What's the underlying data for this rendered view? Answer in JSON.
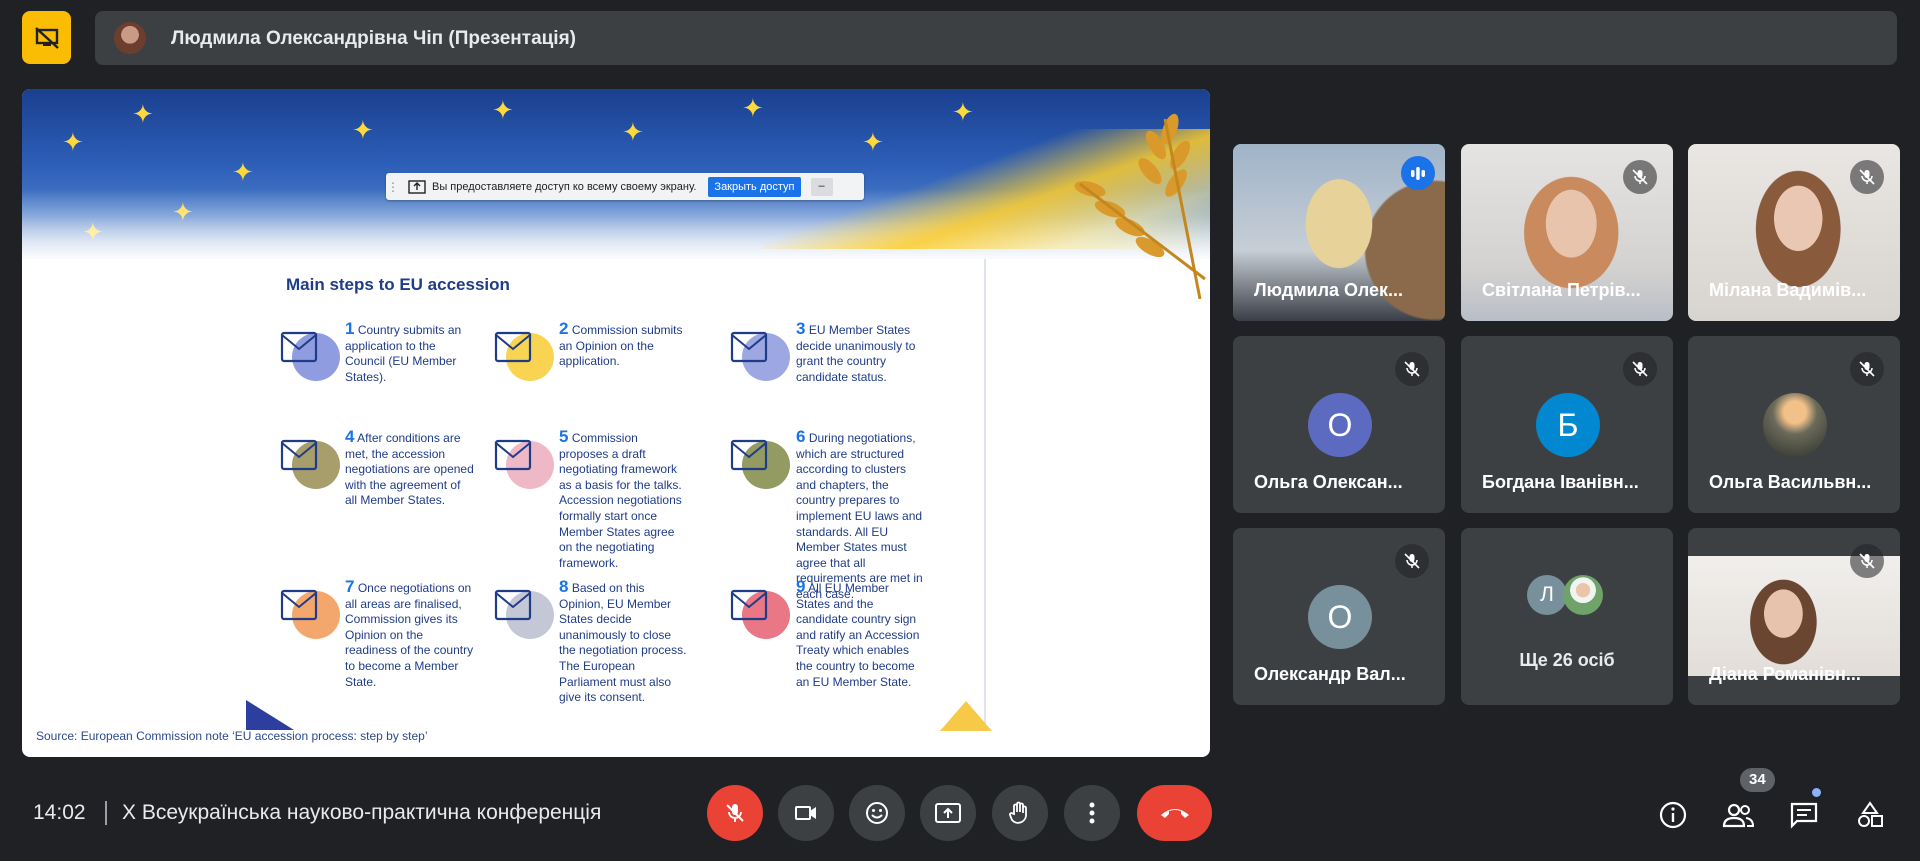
{
  "header": {
    "presenter_title": "Людмила Олександрівна Чіп (Презентація)"
  },
  "share_bar": {
    "message": "Вы предоставляете доступ ко всему своему экрану.",
    "stop_label": "Закрыть доступ"
  },
  "slide": {
    "heading": "Main steps to EU accession",
    "steps": [
      {
        "num": "1",
        "text": "Country submits an application to the Council (EU Member States).",
        "icon": "envelope-icon"
      },
      {
        "num": "2",
        "text": "Commission submits an Opinion on the application.",
        "icon": "speech-bubble-icon"
      },
      {
        "num": "3",
        "text": "EU Member States decide unanimously to grant the country candidate status.",
        "icon": "raised-hands-icon"
      },
      {
        "num": "4",
        "text": "After conditions are met, the accession negotiations are opened with the agreement of all Member States.",
        "icon": "scales-icon"
      },
      {
        "num": "5",
        "text": "Commission proposes a draft negotiating framework as a basis for the talks. Accession negotiations formally start once Member States agree on the negotiating framework.",
        "icon": "document-pen-icon"
      },
      {
        "num": "6",
        "text": "During negotiations, which are structured according to clusters and chapters, the country prepares to implement EU laws and standards. All EU Member States must agree that all requirements are met in each case.",
        "icon": "clipboard-icon"
      },
      {
        "num": "7",
        "text": "Once negotiations on all areas are finalised, Commission gives its Opinion on the readiness of the country to become a Member State.",
        "icon": "handshake-icon"
      },
      {
        "num": "8",
        "text": "Based on this Opinion, EU Member States decide unanimously to close the negotiation process. The European Parliament must also give its consent.",
        "icon": "scroll-icon"
      },
      {
        "num": "9",
        "text": "All EU Member States and the candidate country sign and ratify an Accession Treaty which enables the country to become an EU Member State.",
        "icon": "eu-flag-icon"
      }
    ],
    "source": "Source: European Commission note ‘EU accession process: step by step’"
  },
  "participants": [
    {
      "name": "Людмила Олек...",
      "type": "video",
      "speaking": true
    },
    {
      "name": "Світлана Петрів...",
      "type": "video",
      "muted": true
    },
    {
      "name": "Мілана Вадимів...",
      "type": "video",
      "muted": true
    },
    {
      "name": "Ольга Олексан...",
      "type": "initial",
      "initial": "О",
      "color": "#5c6bc0",
      "muted": true
    },
    {
      "name": "Богдана Іванівн...",
      "type": "initial",
      "initial": "Б",
      "color": "#0288d1",
      "muted": true
    },
    {
      "name": "Ольга Васильвн...",
      "type": "photo",
      "muted": true
    },
    {
      "name": "Олександр Вал...",
      "type": "initial",
      "initial": "О",
      "color": "#78909c",
      "muted": true
    },
    {
      "name": "Діана Романівн...",
      "type": "video",
      "muted": true
    }
  ],
  "more_tile": {
    "initial": "Л",
    "label": "Ще 26 осіб"
  },
  "bottom_bar": {
    "time": "14:02",
    "meeting_title": "X Всеукраїнська науково-практична конференція",
    "people_count": "34"
  },
  "colors": {
    "accent": "#fbbc04",
    "end_call": "#ea4335",
    "background": "#202124",
    "tile": "#3c4043"
  }
}
